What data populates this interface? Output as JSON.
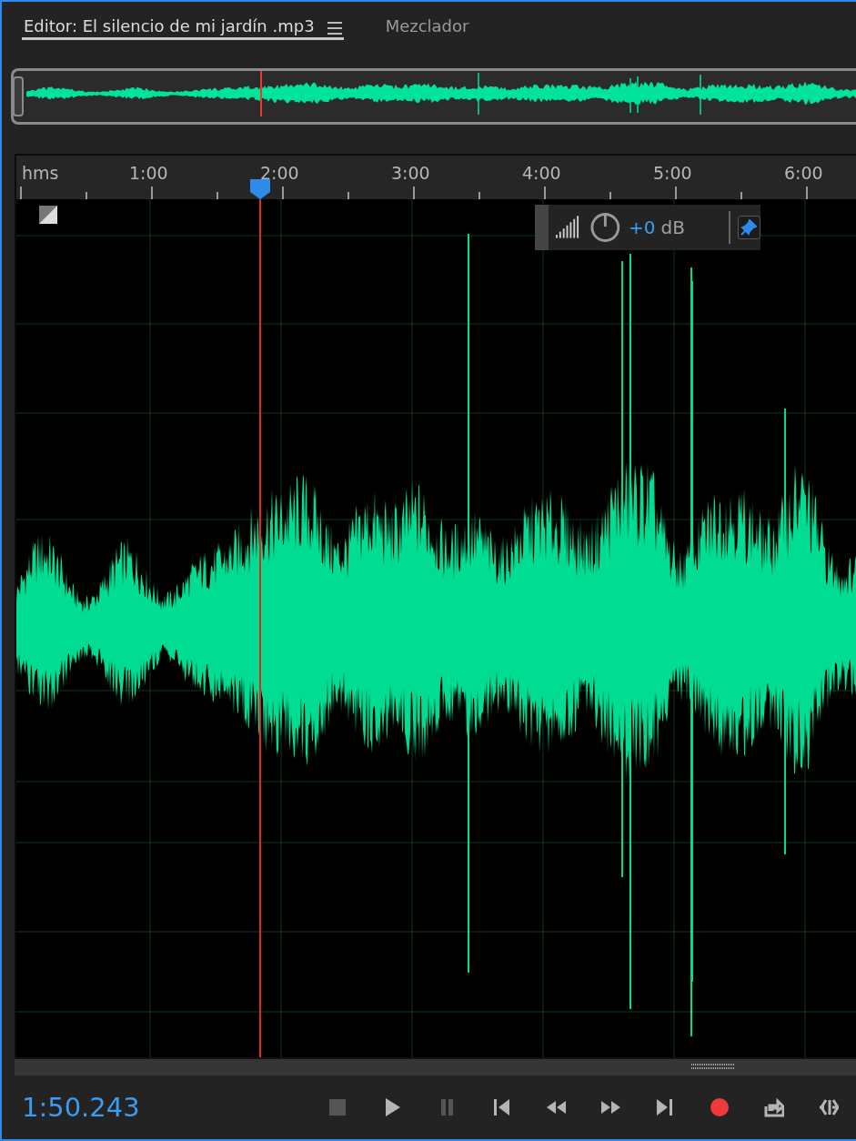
{
  "tabs": [
    {
      "label": "Editor: El silencio de mi jardín .mp3",
      "selected": true,
      "has_menu": true
    },
    {
      "label": "Mezclador",
      "selected": false,
      "has_menu": false
    }
  ],
  "ruler": {
    "labels": [
      "hms",
      "1:00",
      "2:00",
      "3:00",
      "4:00",
      "5:00",
      "6:00"
    ]
  },
  "hud": {
    "value": "+0",
    "unit": "dB"
  },
  "transport": {
    "time": "1:50.243",
    "buttons": [
      {
        "kind": "stop",
        "disabled": true
      },
      {
        "kind": "play",
        "disabled": false
      },
      {
        "kind": "pause",
        "disabled": true
      },
      {
        "kind": "start",
        "disabled": false
      },
      {
        "kind": "rewind",
        "disabled": false
      },
      {
        "kind": "forward",
        "disabled": false
      },
      {
        "kind": "end",
        "disabled": false
      },
      {
        "kind": "record",
        "disabled": false
      },
      {
        "kind": "output",
        "disabled": false
      },
      {
        "kind": "skip",
        "disabled": false
      }
    ]
  }
}
